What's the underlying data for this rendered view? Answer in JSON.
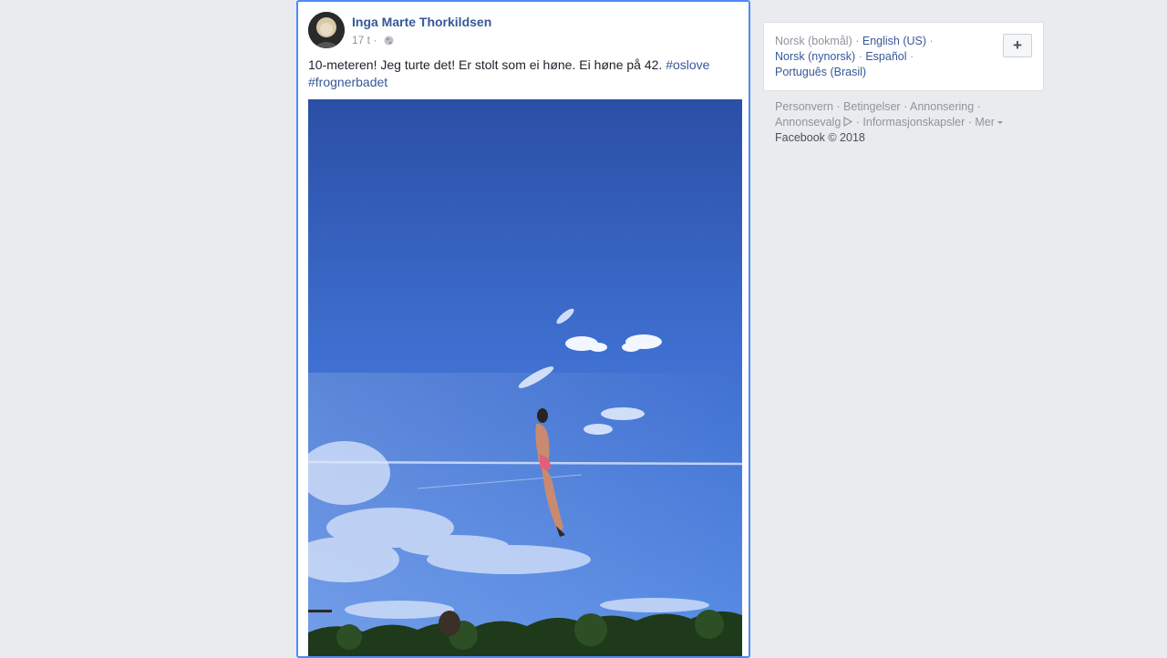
{
  "post": {
    "author": "Inga Marte Thorkildsen",
    "time": "17 t",
    "separator": " · ",
    "text": "10-meteren! Jeg turte det! Er stolt som ei høne. Ei høne på 42. ",
    "hashtags": [
      "#oslove",
      "#frognerbadet"
    ]
  },
  "languages": {
    "current": "Norsk (bokmål)",
    "links": [
      "English (US)",
      "Norsk (nynorsk)",
      "Español",
      "Português (Brasil)"
    ],
    "add_label": "+"
  },
  "footer": {
    "links": [
      "Personvern",
      "Betingelser",
      "Annonsering",
      "Annonsevalg",
      "Informasjonskapsler",
      "Mer"
    ],
    "copyright": "Facebook © 2018"
  },
  "icons": {
    "privacy": "globe-icon",
    "adchoices": "adchoices-icon",
    "more": "caret-down-icon"
  },
  "colors": {
    "background": "#e9ebee",
    "link": "#365899",
    "muted": "#90949c",
    "focus_border": "#4a8cf7"
  }
}
